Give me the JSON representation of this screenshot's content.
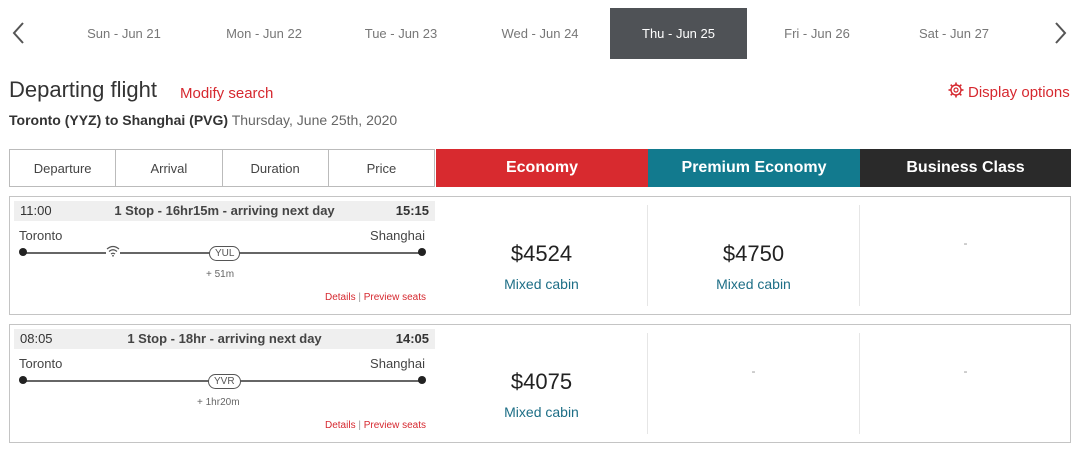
{
  "date_nav": {
    "prev_icon": "chevron-left-icon",
    "next_icon": "chevron-right-icon",
    "dates": [
      {
        "label": "Sun - Jun 21",
        "active": false
      },
      {
        "label": "Mon - Jun 22",
        "active": false
      },
      {
        "label": "Tue - Jun 23",
        "active": false
      },
      {
        "label": "Wed - Jun 24",
        "active": false
      },
      {
        "label": "Thu - Jun 25",
        "active": true
      },
      {
        "label": "Fri - Jun 26",
        "active": false
      },
      {
        "label": "Sat - Jun 27",
        "active": false
      }
    ]
  },
  "header": {
    "title": "Departing flight",
    "modify_label": "Modify search",
    "display_options_label": "Display options",
    "display_options_icon": "gear-icon",
    "route": "Toronto (YYZ) to Shanghai (PVG)",
    "date": "Thursday, June 25th, 2020"
  },
  "sort_options": [
    "Departure",
    "Arrival",
    "Duration",
    "Price"
  ],
  "cabins": {
    "economy": "Economy",
    "premium": "Premium Economy",
    "business": "Business Class"
  },
  "colors": {
    "accent_red": "#d82a2f",
    "premium_teal": "#127a8e",
    "business_black": "#2a2a2a",
    "active_date_bg": "#4f5256",
    "fare_cabin_text": "#1d6e86"
  },
  "flights": [
    {
      "departure_time": "11:00",
      "summary": "1 Stop - 16hr15m - arriving next day",
      "arrival_time": "15:15",
      "origin": "Toronto",
      "destination": "Shanghai",
      "stop_code": "YUL",
      "layover": "+ 51m",
      "wifi_icon": "wifi-icon",
      "details_label": "Details",
      "separator": "|",
      "preview_label": "Preview seats",
      "economy_price": "$4524",
      "economy_cabin": "Mixed cabin",
      "premium_price": "$4750",
      "premium_cabin": "Mixed cabin",
      "business_price": "-"
    },
    {
      "departure_time": "08:05",
      "summary": "1 Stop - 18hr - arriving next day",
      "arrival_time": "14:05",
      "origin": "Toronto",
      "destination": "Shanghai",
      "stop_code": "YVR",
      "layover": "+ 1hr20m",
      "details_label": "Details",
      "separator": "|",
      "preview_label": "Preview seats",
      "economy_price": "$4075",
      "economy_cabin": "Mixed cabin",
      "premium_price": "-",
      "business_price": "-"
    }
  ]
}
